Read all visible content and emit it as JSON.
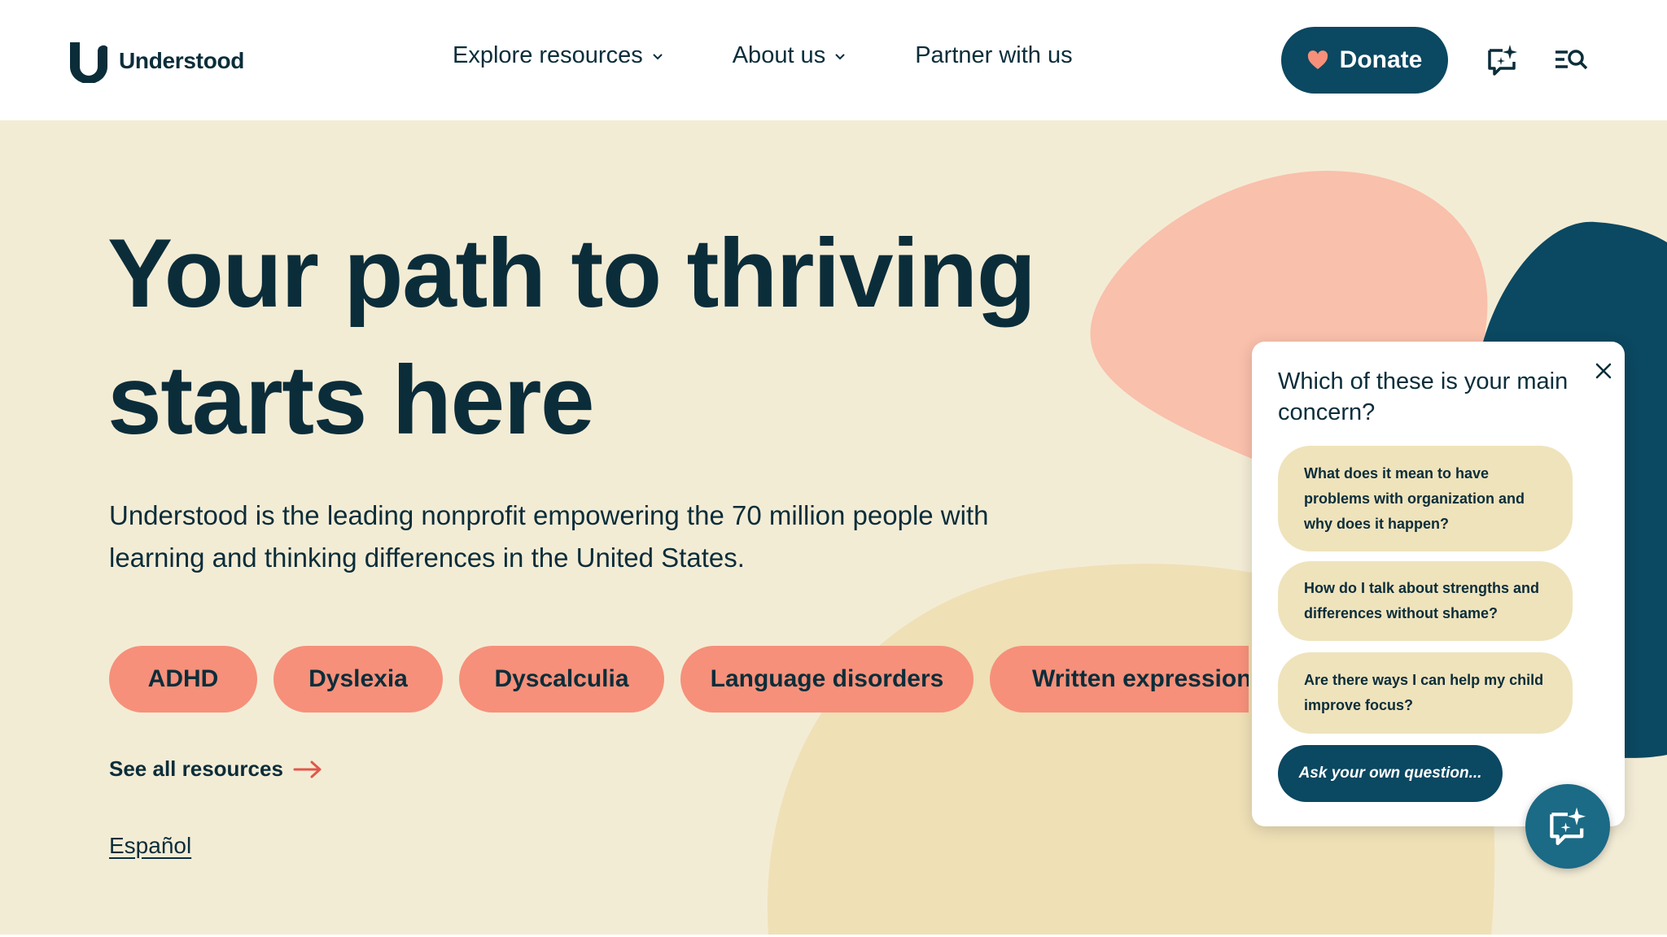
{
  "brand": {
    "name": "Understood"
  },
  "nav": {
    "items": [
      {
        "label": "Explore resources",
        "has_dropdown": true
      },
      {
        "label": "About us",
        "has_dropdown": true
      },
      {
        "label": "Partner with us",
        "has_dropdown": false
      }
    ],
    "donate_label": "Donate",
    "icons": [
      "heart-icon",
      "chat-sparkle-icon",
      "menu-search-icon"
    ]
  },
  "hero": {
    "heading": "Your path to thriving starts here",
    "intro": "Understood is the leading nonprofit empowering the 70 million people with learning and thinking differences in the United States.",
    "chips": [
      "ADHD",
      "Dyslexia",
      "Dyscalculia",
      "Language disorders",
      "Written expression disorder"
    ],
    "see_all_label": "See all resources",
    "espanol_label": "Español"
  },
  "chat": {
    "question": "Which of these is your main concern?",
    "suggestions": [
      "What does it mean to have problems with organization and why does it happen?",
      "How do I talk about strengths and differences without shame?",
      "Are there ways I can help my child improve focus?"
    ],
    "ask_label": "Ask your own question..."
  },
  "colors": {
    "navy": "#0b2d3a",
    "teal": "#0b4861",
    "hero_bg": "#f3ecd5",
    "chip": "#f6907a",
    "pink_blob": "#f9c0ac",
    "sand_blob": "#efe0b6",
    "suggestion_bg": "#efe3bc",
    "accent_red": "#e2574c"
  }
}
